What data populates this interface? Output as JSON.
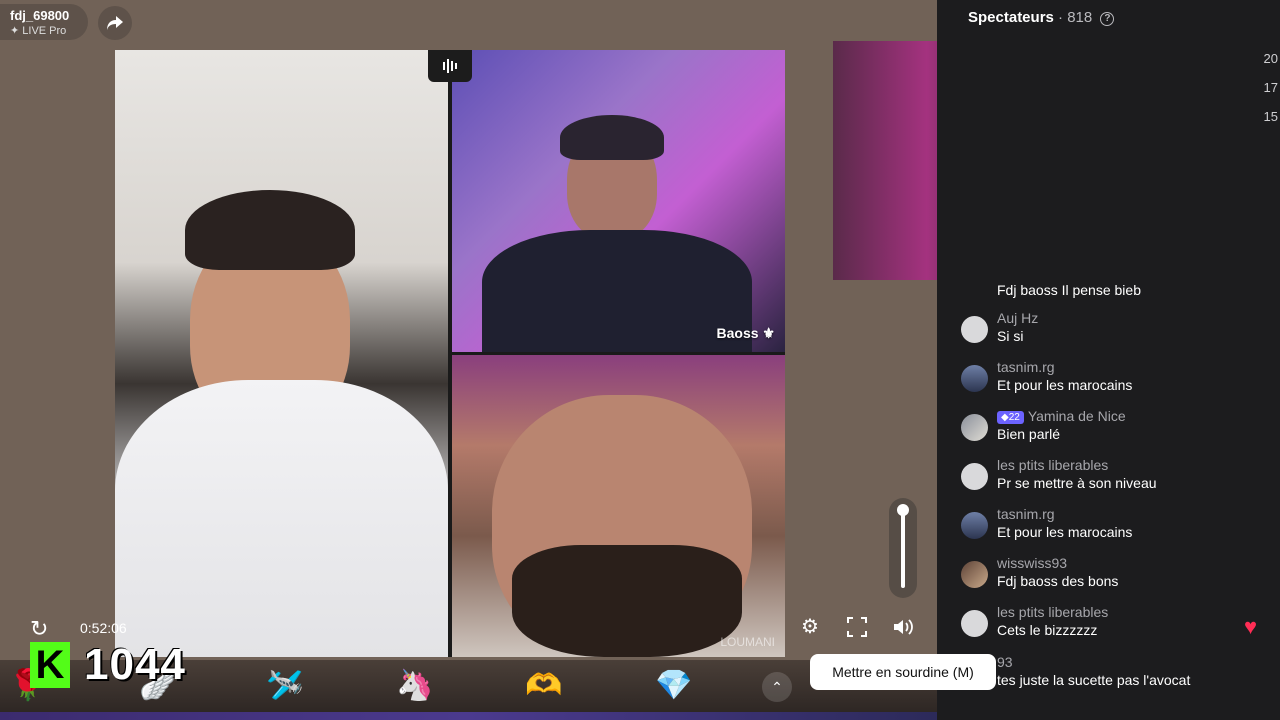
{
  "host": {
    "username": "fdj_69800",
    "subtitle": "LIVE Pro"
  },
  "videos": {
    "top_right_name": "Baoss",
    "bottom_right_watermark": "LOUMANI"
  },
  "panel": {
    "title": "Spectateurs",
    "count": "· 818",
    "side_numbers": [
      "20",
      "17",
      "15"
    ]
  },
  "comments": [
    {
      "user": "",
      "text": "Fdj baoss Il pense bieb",
      "avatar": "none"
    },
    {
      "user": "Auj Hz",
      "text": "Si si",
      "avatar": "plain"
    },
    {
      "user": "tasnim.rg",
      "text": "Et pour les marocains",
      "avatar": "dark"
    },
    {
      "user": "Yamina de Nice",
      "badge": "22",
      "text": "Bien parlé",
      "avatar": "img"
    },
    {
      "user": "les ptits liberables",
      "text": "Pr se mettre à son niveau",
      "avatar": "plain"
    },
    {
      "user": "tasnim.rg",
      "text": "Et pour les marocains",
      "avatar": "dark"
    },
    {
      "user": "wisswiss93",
      "text": "Fdj baoss des bons",
      "avatar": "pic"
    },
    {
      "user": "les ptits liberables",
      "text": "Cets le bizzzzzz",
      "avatar": "plain"
    },
    {
      "user": "93",
      "text": "tes juste la sucette pas l'avocat",
      "avatar": "none"
    }
  ],
  "player": {
    "time": "0:52:06",
    "tooltip": "Mettre en sourdine (M)",
    "volume_level": 1.0
  },
  "score": {
    "logo": "K",
    "value": "1044"
  },
  "icons": [
    "share-icon",
    "replay-icon",
    "settings-icon",
    "fullscreen-icon",
    "volume-icon",
    "help-icon",
    "heart-icon",
    "chevron-up-icon"
  ],
  "gifts": [
    "🌹",
    "🪽",
    "🛩️",
    "🦄",
    "🫶",
    "💎"
  ]
}
